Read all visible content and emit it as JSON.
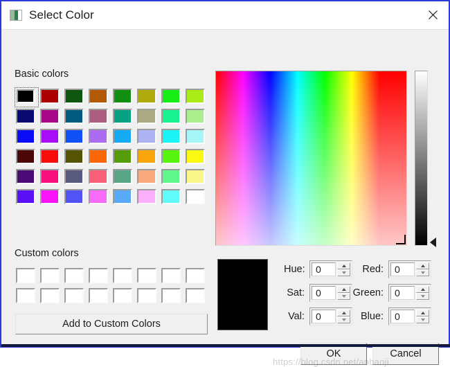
{
  "window": {
    "title": "Select Color",
    "title_icon": "image-icon",
    "close_icon": "close-icon",
    "border_color": "#2b3ad6"
  },
  "basic_colors": {
    "label": "Basic colors",
    "focused_index": 0,
    "swatches": [
      "#000000",
      "#aa0000",
      "#0f5610",
      "#b35a06",
      "#108f10",
      "#b0ab0d",
      "#16ec16",
      "#abeb18",
      "#0a0a72",
      "#a50786",
      "#015a7f",
      "#ac5c7f",
      "#07a184",
      "#aba884",
      "#17f18f",
      "#aaee8c",
      "#0b0bf5",
      "#a70ef7",
      "#1050f6",
      "#ab6cf2",
      "#17aaf4",
      "#adb2f2",
      "#1bf4f4",
      "#a6f6f7",
      "#4b0707",
      "#f80c0c",
      "#545404",
      "#fb6607",
      "#569c09",
      "#f9a50b",
      "#57f410",
      "#f9f914",
      "#4b0b76",
      "#fa0f7e",
      "#5a5a7e",
      "#fa5f78",
      "#58a685",
      "#f9a97e",
      "#5df78c",
      "#f9f78a",
      "#5a10f4",
      "#f814f8",
      "#5253f6",
      "#f86af8",
      "#59aaf8",
      "#faaffa",
      "#5ffaf9",
      "#ffffff"
    ]
  },
  "custom_colors": {
    "label": "Custom colors",
    "swatches": [
      "#ffffff",
      "#ffffff",
      "#ffffff",
      "#ffffff",
      "#ffffff",
      "#ffffff",
      "#ffffff",
      "#ffffff",
      "#ffffff",
      "#ffffff",
      "#ffffff",
      "#ffffff",
      "#ffffff",
      "#ffffff",
      "#ffffff",
      "#ffffff"
    ],
    "add_button_label": "Add to Custom Colors"
  },
  "picker": {
    "gradient_name": "hue-saturation-field",
    "cursor_position": "bottom-right",
    "value_slider_name": "value-slider",
    "value_slider_position": "bottom"
  },
  "preview": {
    "color": "#000000"
  },
  "fields": {
    "hue": {
      "label": "Hue:",
      "value": "0"
    },
    "sat": {
      "label": "Sat:",
      "value": "0"
    },
    "val": {
      "label": "Val:",
      "value": "0"
    },
    "red": {
      "label": "Red:",
      "value": "0"
    },
    "green": {
      "label": "Green:",
      "value": "0"
    },
    "blue": {
      "label": "Blue:",
      "value": "0"
    }
  },
  "buttons": {
    "ok": "OK",
    "cancel": "Cancel"
  },
  "watermark": "https://blog.csdn.net/anbaoji"
}
